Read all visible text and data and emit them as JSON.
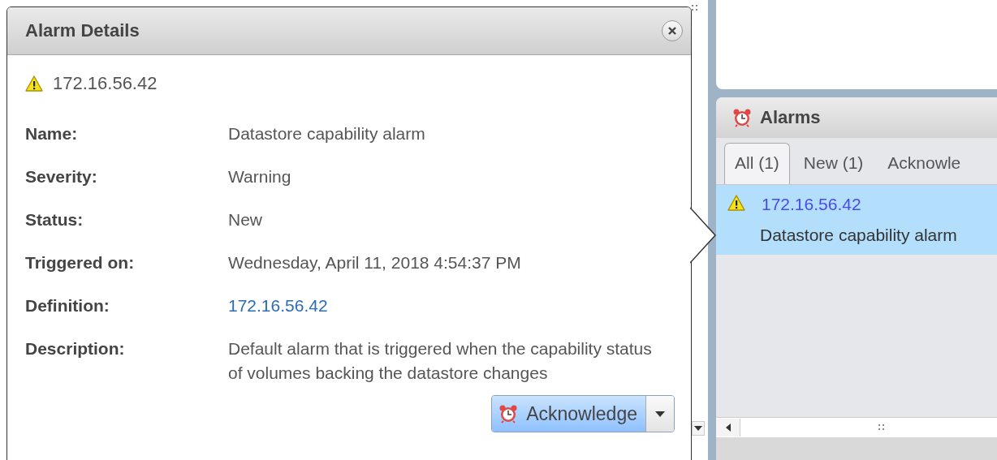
{
  "dialog": {
    "title": "Alarm Details",
    "entity": "172.16.56.42",
    "fields": [
      {
        "label": "Name:",
        "value": "Datastore capability alarm",
        "kind": "text"
      },
      {
        "label": "Severity:",
        "value": "Warning",
        "kind": "text"
      },
      {
        "label": "Status:",
        "value": "New",
        "kind": "text"
      },
      {
        "label": "Triggered on:",
        "value": "Wednesday, April 11, 2018 4:54:37 PM",
        "kind": "text"
      },
      {
        "label": "Definition:",
        "value": "172.16.56.42",
        "kind": "link"
      },
      {
        "label": "Description:",
        "value": "Default alarm that is triggered when the capability status of volumes backing the datastore changes",
        "kind": "text"
      }
    ],
    "action_button": "Acknowledge"
  },
  "alarms_panel": {
    "title": "Alarms",
    "tabs": [
      {
        "label": "All (1)",
        "selected": true
      },
      {
        "label": "New (1)",
        "selected": false
      },
      {
        "label": "Acknowle",
        "selected": false
      }
    ],
    "items": [
      {
        "entity": "172.16.56.42",
        "name": "Datastore capability alarm",
        "selected": true
      }
    ]
  }
}
